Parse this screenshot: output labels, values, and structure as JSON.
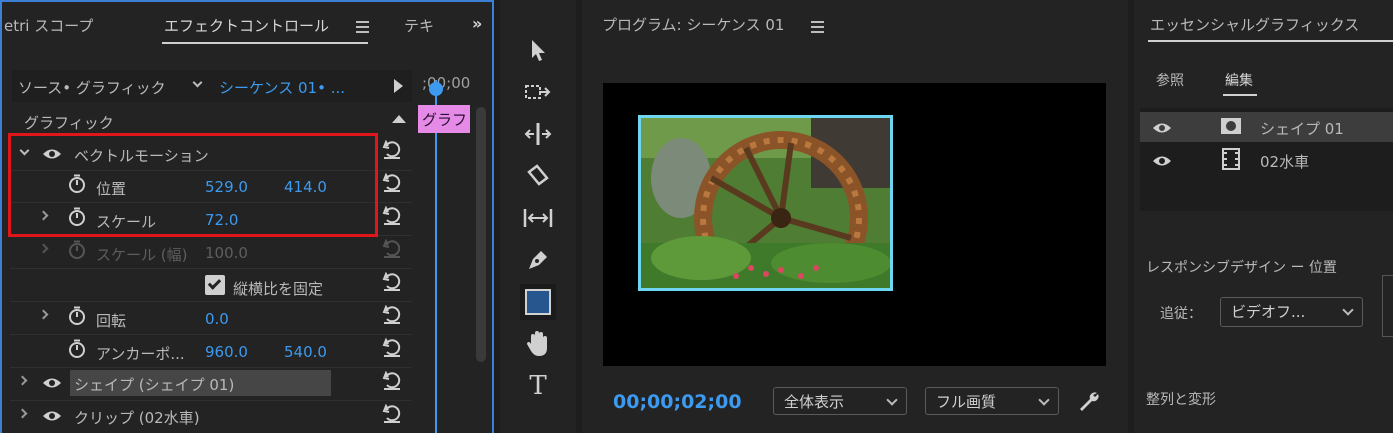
{
  "effect_panel": {
    "tabs": [
      "etri スコープ",
      "エフェクトコントロール",
      "テキ"
    ],
    "source_label": "ソース• グラフィック",
    "sequence_label": "シーケンス 01• ...",
    "timecode": ";00;00",
    "clip_label": "グラフ",
    "section_title": "グラフィック",
    "vector_motion": "ベクトルモーション",
    "position_label": "位置",
    "position_x": "529.0",
    "position_y": "414.0",
    "scale_label": "スケール",
    "scale_value": "72.0",
    "scale_width_label": "スケール (幅)",
    "scale_width_value": "100.0",
    "lock_ratio_label": "縦横比を固定",
    "lock_ratio_checked": true,
    "rotation_label": "回転",
    "rotation_value": "0.0",
    "anchor_label": "アンカーポ...",
    "anchor_x": "960.0",
    "anchor_y": "540.0",
    "shape_layer": "シェイプ (シェイプ 01)",
    "clip_layer": "クリップ (02水車)"
  },
  "tools": [
    "selection-icon",
    "track-select-icon",
    "ripple-edit-icon",
    "razor-icon",
    "slip-icon",
    "pen-icon",
    "rectangle-icon",
    "hand-icon",
    "type-icon"
  ],
  "program": {
    "title": "プログラム: シーケンス 01",
    "timecode": "00;00;02;00",
    "zoom": "全体表示",
    "quality": "フル画質"
  },
  "essential": {
    "title": "エッセンシャルグラフィックス",
    "tabs": [
      "参照",
      "編集"
    ],
    "layers": [
      {
        "name": "シェイプ 01"
      },
      {
        "name": "02水車"
      }
    ],
    "responsive_title": "レスポンシブデザイン ー 位置",
    "follow_label": "追従：",
    "follow_value": "ビデオフ...",
    "align_title": "整列と変形"
  },
  "colors": {
    "accent_blue": "#3c9af0",
    "highlight_red": "#e0161b",
    "clip_pink": "#e58ae6"
  }
}
